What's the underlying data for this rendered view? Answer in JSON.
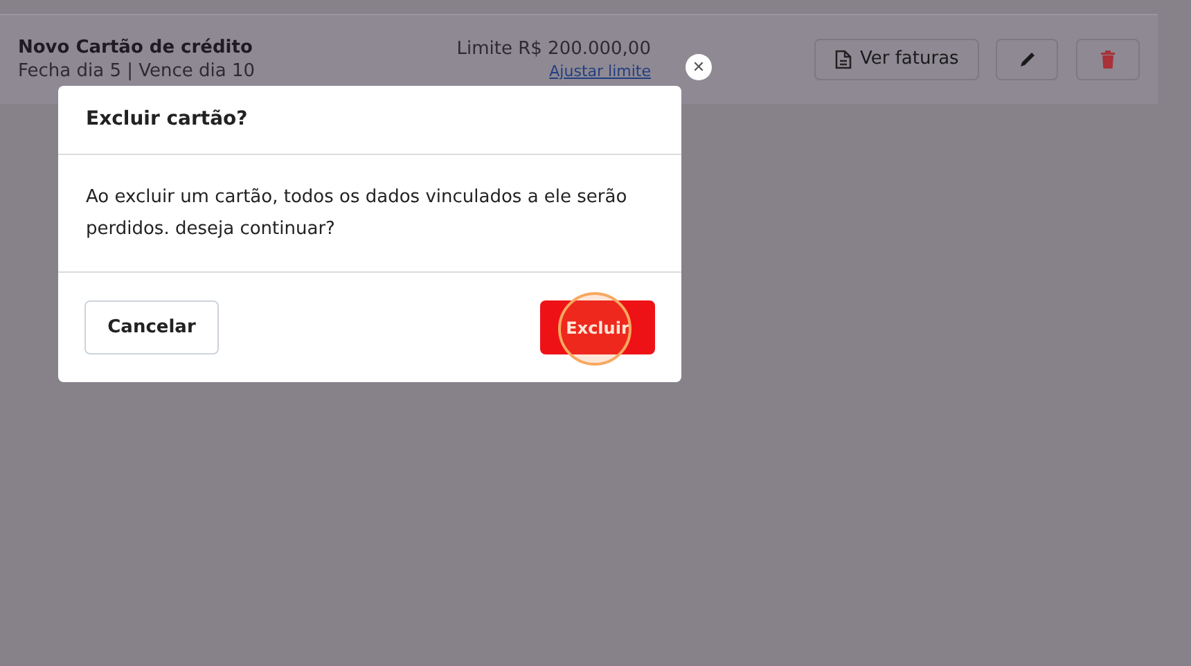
{
  "card": {
    "name": "Novo Cartão de crédito",
    "schedule": "Fecha dia 5 | Vence dia 10",
    "limit": "Limite R$ 200.000,00",
    "adjust_link": "Ajustar limite",
    "invoices_button": "Ver faturas"
  },
  "dialog": {
    "title": "Excluir cartão?",
    "message": "Ao excluir um cartão, todos os dados vinculados a ele serão perdidos. deseja continuar?",
    "cancel_button": "Cancelar",
    "confirm_button": "Excluir",
    "close_button": "✕"
  }
}
